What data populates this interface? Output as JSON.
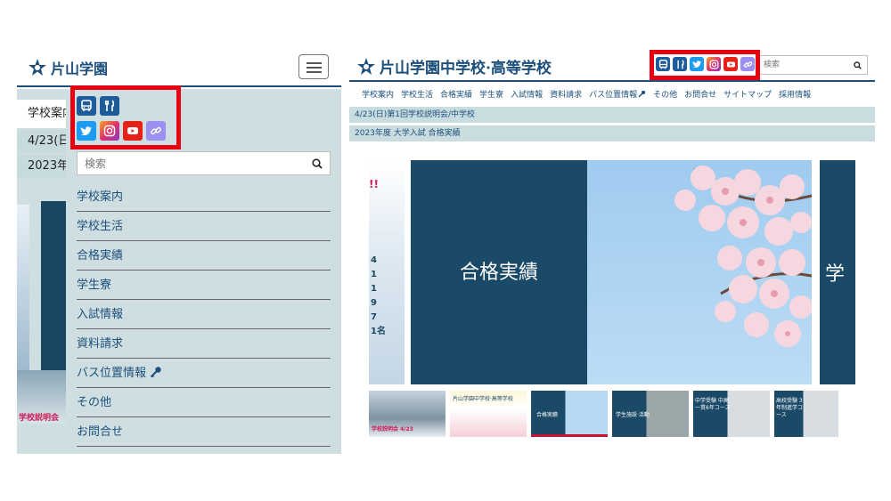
{
  "mobile": {
    "logo_text": "片山学園",
    "menu_button_label": "",
    "bg_rows": [
      "学校案内",
      "4/23(日",
      "2023年"
    ],
    "bg_thumb_text": "学校説明会",
    "search": {
      "placeholder": "検索"
    },
    "menu_items": [
      "学校案内",
      "学校生活",
      "合格実績",
      "学生寮",
      "入試情報",
      "資料請求",
      "バス位置情報",
      "その他",
      "お問合せ"
    ]
  },
  "desktop": {
    "logo_text": "片山学園中学校·高等学校",
    "search": {
      "placeholder": "検索"
    },
    "nav": [
      "学校案内",
      "学校生活",
      "合格実績",
      "学生寮",
      "入試情報",
      "資料請求",
      "バス位置情報",
      "その他",
      "お問合せ",
      "サイトマップ",
      "採用情報"
    ],
    "notices": [
      "4/23(日)第1回学校説明会/中学校",
      "2023年度 大学入試 合格実績"
    ],
    "slide": {
      "title": "合格実績",
      "next_title_partial": "学"
    },
    "slide_left": {
      "exclaim": "!!",
      "nums": [
        "4",
        "1",
        "1",
        "9",
        "7",
        "1名"
      ]
    },
    "thumbs": [
      {
        "label": "学校説明会 4/23"
      },
      {
        "label": "片山学園中学校·高等学校"
      },
      {
        "label": "合格実績"
      },
      {
        "label": "学生施設·活動"
      },
      {
        "label": "中学受験 中高一貫6年コース"
      },
      {
        "label": "高校受験 3年制進学コース"
      }
    ]
  },
  "social_icons": [
    "bus-icon",
    "restaurant-icon",
    "twitter-icon",
    "instagram-icon",
    "youtube-icon",
    "link-icon"
  ],
  "colors": {
    "navy": "#1a4a67",
    "brand_blue": "#1d4f7c",
    "menu_bg": "#cfdfe1",
    "highlight": "#e60012"
  }
}
